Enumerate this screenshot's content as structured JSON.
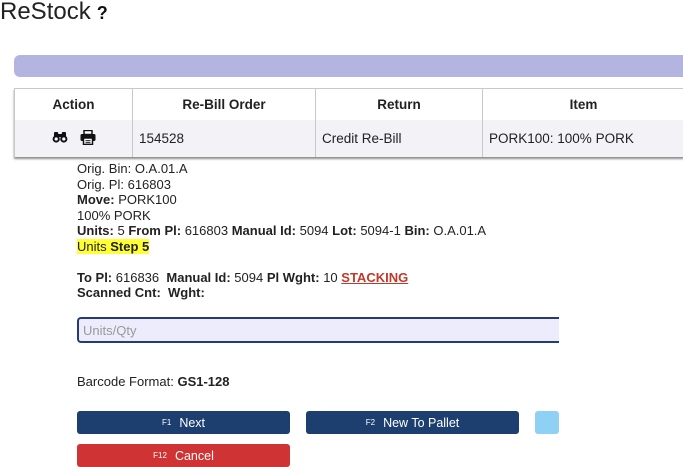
{
  "header": {
    "title": "ReStock",
    "help_symbol": "?"
  },
  "table": {
    "columns": [
      "Action",
      "Re-Bill Order",
      "Return",
      "Item"
    ],
    "rows": [
      {
        "actions": [
          "binoculars-icon",
          "print-icon"
        ],
        "rebill_order": "154528",
        "return": "Credit Re-Bill",
        "item": "PORK100: 100% PORK"
      }
    ]
  },
  "details": {
    "orig_bin_label": "Orig. Bin:",
    "orig_bin_value": "O.A.01.A",
    "orig_pl_label": "Orig. Pl:",
    "orig_pl_value": "616803",
    "move_label": "Move:",
    "move_value": "PORK100",
    "description": "100% PORK",
    "units_label": "Units:",
    "units_value": "5",
    "from_pl_label": "From Pl:",
    "from_pl_value": "616803",
    "manual_id_label": "Manual Id:",
    "manual_id_value": "5094",
    "lot_label": "Lot:",
    "lot_value": "5094-1",
    "bin_label": "Bin:",
    "bin_value": "O.A.01.A",
    "step_prefix": "Units",
    "step_label": "Step 5",
    "to_pl_label": "To Pl:",
    "to_pl_value": "616836",
    "to_manual_id_label": "Manual Id:",
    "to_manual_id_value": "5094",
    "pl_wght_label": "Pl Wght:",
    "pl_wght_value": "10",
    "stacking_link": "STACKING",
    "scanned_cnt_label": "Scanned Cnt:",
    "wght_label": "Wght:"
  },
  "input": {
    "placeholder": "Units/Qty",
    "value": ""
  },
  "barcode": {
    "label": "Barcode Format:",
    "value": "GS1-128"
  },
  "buttons": {
    "next": {
      "key": "F1",
      "label": "Next"
    },
    "new_pallet": {
      "key": "F2",
      "label": "New To Pallet"
    },
    "cancel": {
      "key": "F12",
      "label": "Cancel"
    }
  },
  "colors": {
    "accent": "#1c3f70",
    "cancel": "#cf3333",
    "highlight": "#ffff33",
    "bar": "#b4b4e0",
    "link": "#c0392b",
    "light_blue": "#8fd1f5"
  }
}
